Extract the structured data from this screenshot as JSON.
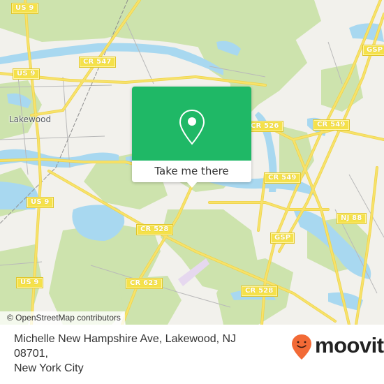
{
  "map": {
    "place_label": "Lakewood",
    "attribution": "© OpenStreetMap contributors",
    "route_shields": [
      {
        "id": "us9-top",
        "label": "US 9"
      },
      {
        "id": "us9-mid",
        "label": "US 9"
      },
      {
        "id": "us9-lower",
        "label": "US 9"
      },
      {
        "id": "us9-bottom",
        "label": "US 9"
      },
      {
        "id": "cr547",
        "label": "CR 547"
      },
      {
        "id": "cr526",
        "label": "CR 526"
      },
      {
        "id": "cr549-right",
        "label": "CR 549"
      },
      {
        "id": "cr549-left",
        "label": "CR 549"
      },
      {
        "id": "gsp-top",
        "label": "GSP"
      },
      {
        "id": "gsp-mid",
        "label": "GSP"
      },
      {
        "id": "nj88",
        "label": "NJ 88"
      },
      {
        "id": "cr528-left",
        "label": "CR 528"
      },
      {
        "id": "cr528-right",
        "label": "CR 528"
      },
      {
        "id": "cr623",
        "label": "CR 623"
      }
    ],
    "colors": {
      "land": "#f2f1ec",
      "forest": "#cde3ad",
      "water": "#a8d8f0",
      "road": "#f7e26a",
      "minor_road": "#b9b9b9"
    }
  },
  "popup": {
    "icon": "location-pin-icon",
    "button_label": "Take me there",
    "color": "#1fb866"
  },
  "footer": {
    "address_line1": "Michelle New Hampshire Ave, Lakewood, NJ 08701,",
    "address_line2": "New York City",
    "brand": "moovit",
    "brand_color": "#f26a36"
  }
}
